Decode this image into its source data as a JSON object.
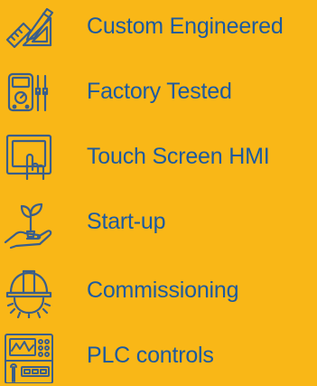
{
  "colors": {
    "background": "#F9B717",
    "text": "#1C5AA0",
    "icon": "#3A5E8A"
  },
  "features": [
    {
      "icon": "drafting-tools-icon",
      "label": "Custom Engineered"
    },
    {
      "icon": "multimeter-icon",
      "label": "Factory Tested"
    },
    {
      "icon": "touch-screen-hmi-icon",
      "label": "Touch Screen HMI"
    },
    {
      "icon": "hand-plant-icon",
      "label": "Start-up"
    },
    {
      "icon": "hardhat-gear-icon",
      "label": "Commissioning"
    },
    {
      "icon": "control-panel-icon",
      "label": "PLC controls"
    }
  ]
}
